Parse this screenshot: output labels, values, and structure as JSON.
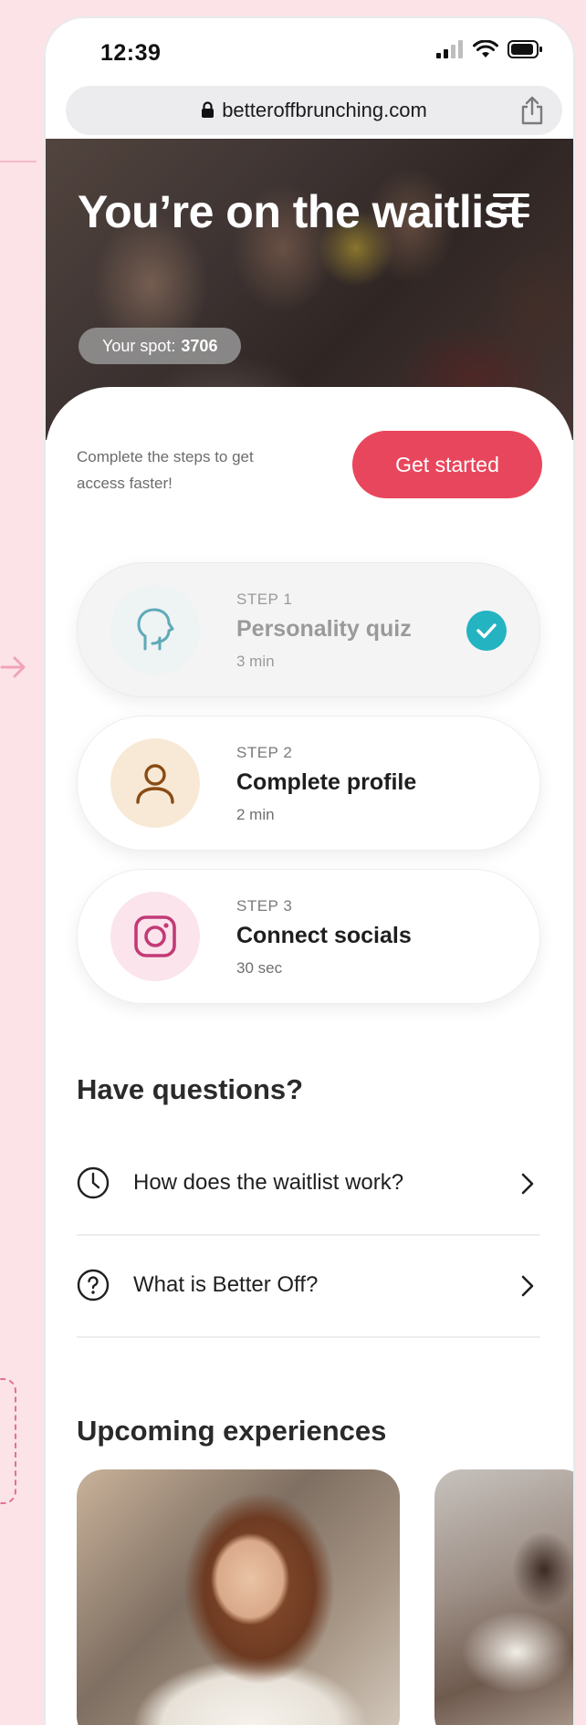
{
  "status_bar": {
    "time": "12:39"
  },
  "browser": {
    "url": "betteroffbrunching.com"
  },
  "hero": {
    "title": "You’re on the waitlist",
    "spot_label": "Your spot:",
    "spot_value": "3706"
  },
  "intro": {
    "text": "Complete the steps to get access faster!",
    "cta_label": "Get started"
  },
  "steps": [
    {
      "label": "STEP 1",
      "title": "Personality quiz",
      "duration": "3 min",
      "completed": true,
      "icon": "head-icon"
    },
    {
      "label": "STEP 2",
      "title": "Complete profile",
      "duration": "2 min",
      "completed": false,
      "icon": "person-icon"
    },
    {
      "label": "STEP 3",
      "title": "Connect socials",
      "duration": "30 sec",
      "completed": false,
      "icon": "instagram-icon"
    }
  ],
  "faq": {
    "heading": "Have questions?",
    "items": [
      {
        "text": "How does the waitlist work?",
        "icon": "clock-icon"
      },
      {
        "text": "What is Better Off?",
        "icon": "question-circle-icon"
      }
    ]
  },
  "experiences": {
    "heading": "Upcoming experiences"
  },
  "colors": {
    "accent": "#e8465c",
    "check": "#24b3c1",
    "canvas": "#fbe3e8",
    "step1_circle": "#eef3f3",
    "step2_circle": "#f8e9d6",
    "step3_circle": "#fbe4ec"
  }
}
